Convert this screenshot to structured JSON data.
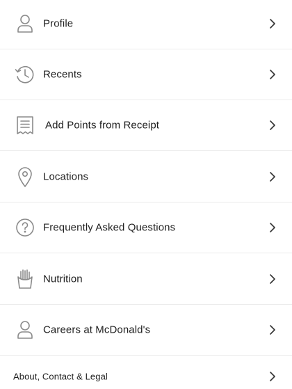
{
  "menu": {
    "items": [
      {
        "label": "Profile",
        "icon": "person-icon"
      },
      {
        "label": "Recents",
        "icon": "history-icon"
      },
      {
        "label": "Add Points from Receipt",
        "icon": "receipt-icon"
      },
      {
        "label": "Locations",
        "icon": "location-pin-icon"
      },
      {
        "label": "Frequently Asked Questions",
        "icon": "question-circle-icon"
      },
      {
        "label": "Nutrition",
        "icon": "fries-icon"
      },
      {
        "label": "Careers at McDonald's",
        "icon": "person-icon"
      },
      {
        "label": "About, Contact & Legal",
        "icon": ""
      }
    ]
  },
  "colors": {
    "icon_stroke": "#8a8a8a",
    "text": "#202020",
    "divider": "#ececec",
    "chevron": "#333333"
  }
}
